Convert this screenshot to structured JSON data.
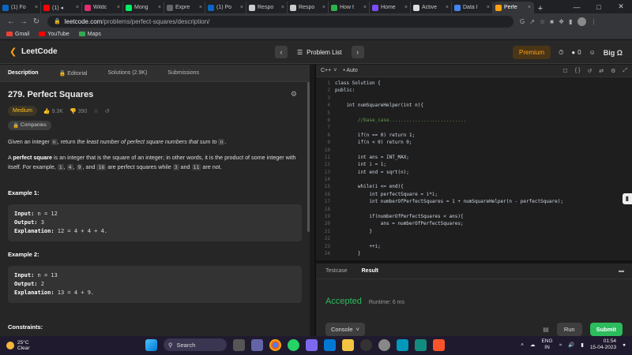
{
  "browser": {
    "tabs": [
      {
        "title": "(1) Fo",
        "color": "#0a66c2",
        "active": false
      },
      {
        "title": "(1) ◂",
        "color": "#ff0000",
        "active": false
      },
      {
        "title": "Wildc",
        "color": "#e1306c",
        "active": false
      },
      {
        "title": "Mong",
        "color": "#00ed64",
        "active": false
      },
      {
        "title": "Expre",
        "color": "#666666",
        "active": false
      },
      {
        "title": "(1) Po",
        "color": "#0a66c2",
        "active": false
      },
      {
        "title": "Respo",
        "color": "#cccccc",
        "active": false
      },
      {
        "title": "Respo",
        "color": "#cccccc",
        "active": false
      },
      {
        "title": "How t",
        "color": "#2bb24c",
        "active": false
      },
      {
        "title": "Home",
        "color": "#7c4dff",
        "active": false
      },
      {
        "title": "Active",
        "color": "#dddddd",
        "active": false
      },
      {
        "title": "Data I",
        "color": "#4285f4",
        "active": false
      },
      {
        "title": "Perfe",
        "color": "#ffa116",
        "active": true
      }
    ],
    "new_tab": "+",
    "url_host": "leetcode.com",
    "url_path": "/problems/perfect-squares/description/",
    "bookmarks": [
      {
        "label": "Gmail",
        "color": "#ea4335"
      },
      {
        "label": "YouTube",
        "color": "#ff0000"
      },
      {
        "label": "Maps",
        "color": "#34a853"
      }
    ]
  },
  "header": {
    "logo": "LeetCode",
    "problem_list": "Problem List",
    "premium": "Premium",
    "count": "0",
    "user": "Big Ω"
  },
  "left": {
    "tabs": [
      "Description",
      "Editorial",
      "Solutions (2.9K)",
      "Submissions"
    ],
    "title": "279. Perfect Squares",
    "difficulty": "Medium",
    "likes": "9.3K",
    "dislikes": "390",
    "companies": "Companies",
    "p1_a": "Given an integer ",
    "p1_n": "n",
    "p1_b": ", return ",
    "p1_i": "the least number of perfect square numbers that sum to",
    "p1_c": " ",
    "p1_n2": "n",
    "p1_d": ".",
    "p2_a": "A ",
    "p2_b": "perfect square",
    "p2_c": " is an integer that is the square of an integer; in other words, it is the product of some integer with itself. For example, ",
    "p2_1": "1",
    "p2_4": "4",
    "p2_9": "9",
    "p2_16": "16",
    "p2_d": " are perfect squares while ",
    "p2_3": "3",
    "p2_and": " and ",
    "p2_11": "11",
    "p2_e": " are not.",
    "example1": {
      "heading": "Example 1:",
      "input_label": "Input:",
      "input": " n = 12",
      "output_label": "Output:",
      "output": " 3",
      "expl_label": "Explanation:",
      "expl": " 12 = 4 + 4 + 4."
    },
    "example2": {
      "heading": "Example 2:",
      "input_label": "Input:",
      "input": " n = 13",
      "output_label": "Output:",
      "output": " 2",
      "expl_label": "Explanation:",
      "expl": " 13 = 4 + 9."
    },
    "constraints": "Constraints:"
  },
  "editor": {
    "language": "C++",
    "mode": "Auto",
    "lines": [
      "class Solution {",
      "public:",
      "",
      "    int numSquareHelper(int n){",
      "",
      "        //base_case...........................",
      "",
      "        if(n == 0) return 1;",
      "        if(n < 0) return 0;",
      "",
      "        int ans = INT_MAX;",
      "        int i = 1;",
      "        int end = sqrt(n);",
      "",
      "        while(i <= end){",
      "            int perfectSquare = i*i;",
      "            int numberOfPerfectSquares = 1 + numSquareHelper(n - perfectSquare);",
      "",
      "            if(numberOfPerfectSquares < ans){",
      "                ans = numberOfPerfectSquares;",
      "            }",
      "",
      "            ++i;",
      "        }"
    ]
  },
  "console": {
    "tabs": [
      "Testcase",
      "Result"
    ],
    "status": "Accepted",
    "runtime": "Runtime: 6 ms",
    "console_label": "Console",
    "run": "Run",
    "submit": "Submit"
  },
  "taskbar": {
    "temp": "25°C",
    "weather": "Clear",
    "search": "Search",
    "lang1": "ENG",
    "lang2": "IN",
    "time": "01:54",
    "date": "15-04-2023"
  }
}
